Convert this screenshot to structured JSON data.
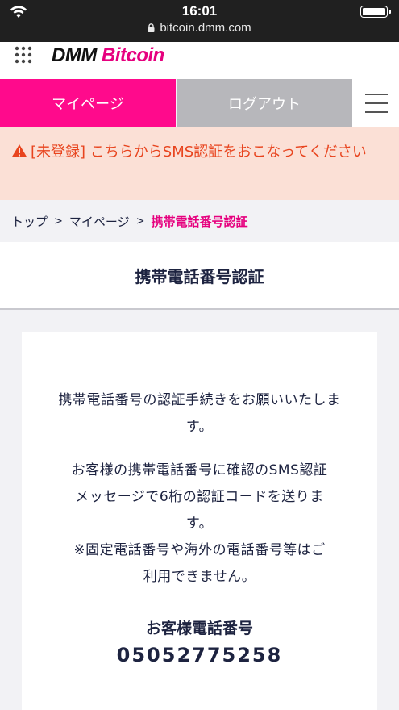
{
  "status_bar": {
    "time": "16:01",
    "url": "bitcoin.dmm.com"
  },
  "header": {
    "logo_dmm": "DMM",
    "logo_bitcoin": "Bitcoin",
    "brand_color": "#e6007e"
  },
  "nav": {
    "mypage_label": "マイページ",
    "logout_label": "ログアウト",
    "mypage_color": "#ff0a8c",
    "logout_color": "#b7b7bb"
  },
  "alert": {
    "tag": "[未登録]",
    "message": "こちらからSMS認証をおこなってください",
    "color": "#e8441e"
  },
  "breadcrumb": {
    "items": [
      "トップ",
      "マイページ",
      "携帯電話番号認証"
    ],
    "separator": ">"
  },
  "page": {
    "title": "携帯電話番号認証"
  },
  "content": {
    "paragraph1": "携帯電話番号の認証手続きをお願いいたします。",
    "paragraph2_line1": "お客様の携帯電話番号に確認のSMS認証",
    "paragraph2_line2": "メッセージで6桁の認証コードを送りま",
    "paragraph2_line3": "す。",
    "paragraph2_line4": "※固定電話番号や海外の電話番号等はご",
    "paragraph2_line5": "利用できません。",
    "phone_label": "お客様電話番号",
    "phone_number": "05052775258"
  }
}
